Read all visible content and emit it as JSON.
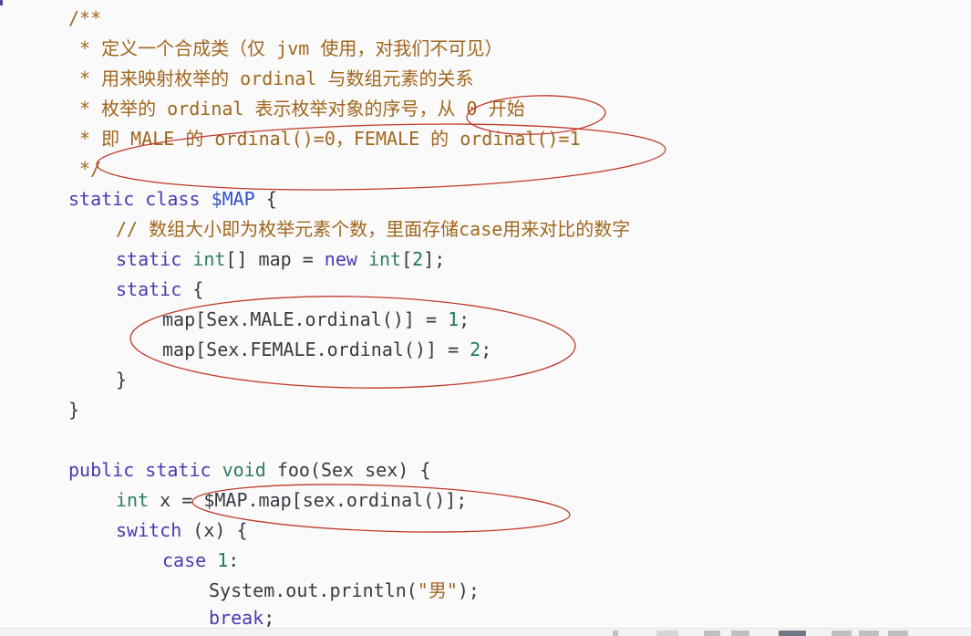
{
  "code": {
    "l1": "/**",
    "l2": " * 定义一个合成类（仅 jvm 使用，对我们不可见）",
    "l3": " * 用来映射枚举的 ordinal 与数组元素的关系",
    "l4": " * 枚举的 ordinal 表示枚举对象的序号，从 0 开始",
    "l5": " * 即 MALE 的 ordinal()=0，FEMALE 的 ordinal()=1",
    "l6": " */",
    "l7": {
      "k1": "static",
      "k2": "class",
      "name": "$MAP",
      "brace": "{"
    },
    "l8": "// 数组大小即为枚举元素个数，里面存储case用来对比的数字",
    "l9": {
      "k1": "static",
      "t1": "int",
      "mid": "[] map = ",
      "k2": "new",
      "t2": "int",
      "lb": "[",
      "n": "2",
      "rb": "];"
    },
    "l10": {
      "k1": "static",
      "brace": "{"
    },
    "l11": {
      "a": "map[Sex.MALE.ordinal()] = ",
      "n": "1",
      "b": ";"
    },
    "l12": {
      "a": "map[Sex.FEMALE.ordinal()] = ",
      "n": "2",
      "b": ";"
    },
    "l13": "}",
    "l14": "}",
    "l15": {
      "k1": "public",
      "k2": "static",
      "t1": "void",
      "rest": "foo(Sex sex) {"
    },
    "l16": {
      "t1": "int",
      "rest": "x = $MAP.map[sex.ordinal()];"
    },
    "l17": {
      "k1": "switch",
      "rest": "(x) {"
    },
    "l18": {
      "k1": "case",
      "n": "1",
      "rest": ":"
    },
    "l19": {
      "a": "System.out.println(",
      "s": "\"男\"",
      "b": ");"
    },
    "l20": {
      "k1": "break",
      "rest": ";"
    }
  },
  "annotations": {
    "color": "#c0392b",
    "count": 4
  }
}
